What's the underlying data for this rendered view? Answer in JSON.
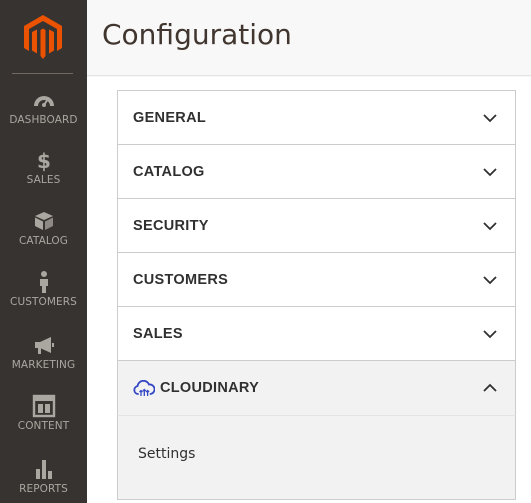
{
  "header": {
    "title": "Configuration"
  },
  "sidebar": {
    "items": [
      {
        "label": "DASHBOARD",
        "icon": "dashboard-icon"
      },
      {
        "label": "SALES",
        "icon": "dollar-icon"
      },
      {
        "label": "CATALOG",
        "icon": "box-icon"
      },
      {
        "label": "CUSTOMERS",
        "icon": "person-icon"
      },
      {
        "label": "MARKETING",
        "icon": "megaphone-icon"
      },
      {
        "label": "CONTENT",
        "icon": "layout-icon"
      },
      {
        "label": "REPORTS",
        "icon": "bar-chart-icon"
      }
    ]
  },
  "config": {
    "sections": [
      {
        "label": "GENERAL",
        "expanded": false
      },
      {
        "label": "CATALOG",
        "expanded": false
      },
      {
        "label": "SECURITY",
        "expanded": false
      },
      {
        "label": "CUSTOMERS",
        "expanded": false
      },
      {
        "label": "SALES",
        "expanded": false
      },
      {
        "label": "CLOUDINARY",
        "expanded": true,
        "icon": "cloudinary-icon"
      }
    ],
    "cloudinary_items": [
      {
        "label": "Settings"
      }
    ]
  },
  "colors": {
    "sidebar_bg": "#373330",
    "logo_orange": "#eb5202",
    "cloudinary_blue": "#3448c5",
    "nav_text": "#aaa6a0"
  }
}
